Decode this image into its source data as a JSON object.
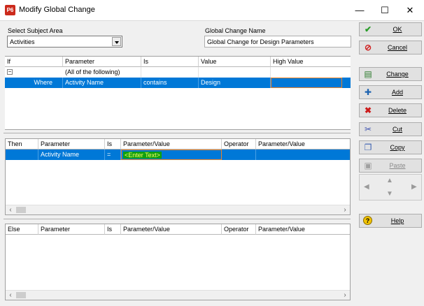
{
  "window": {
    "app_icon": "P6",
    "title": "Modify Global Change",
    "minimize_glyph": "—",
    "maximize_glyph": "☐",
    "close_glyph": "✕"
  },
  "subject": {
    "label": "Select Subject Area",
    "value": "Activities"
  },
  "name": {
    "label": "Global Change Name",
    "value": "Global Change for Design Parameters"
  },
  "if_grid": {
    "headers": [
      "If",
      "Parameter",
      "Is",
      "Value",
      "High Value"
    ],
    "group_toggle": "−",
    "group_label": "(All of the following)",
    "row": {
      "keyword": "Where",
      "parameter": "Activity Name",
      "is": "contains",
      "value": "Design",
      "high_value": ""
    }
  },
  "then_grid": {
    "headers": [
      "Then",
      "Parameter",
      "Is",
      "Parameter/Value",
      "Operator",
      "Parameter/Value"
    ],
    "row": {
      "keyword": "",
      "parameter": "Activity Name",
      "is": "=",
      "value": "<Enter Text>",
      "operator": "",
      "value2": ""
    }
  },
  "else_grid": {
    "headers": [
      "Else",
      "Parameter",
      "Is",
      "Parameter/Value",
      "Operator",
      "Parameter/Value"
    ]
  },
  "buttons": {
    "ok": "OK",
    "cancel": "Cancel",
    "change": "Change",
    "add": "Add",
    "delete": "Delete",
    "cut": "Cut",
    "copy": "Copy",
    "paste": "Paste",
    "help": "Help"
  },
  "colors": {
    "selection": "#0078d7",
    "highlight_text_bg": "#10a010",
    "highlight_text_fg": "#ffff66",
    "edit_border": "#e8822a"
  }
}
